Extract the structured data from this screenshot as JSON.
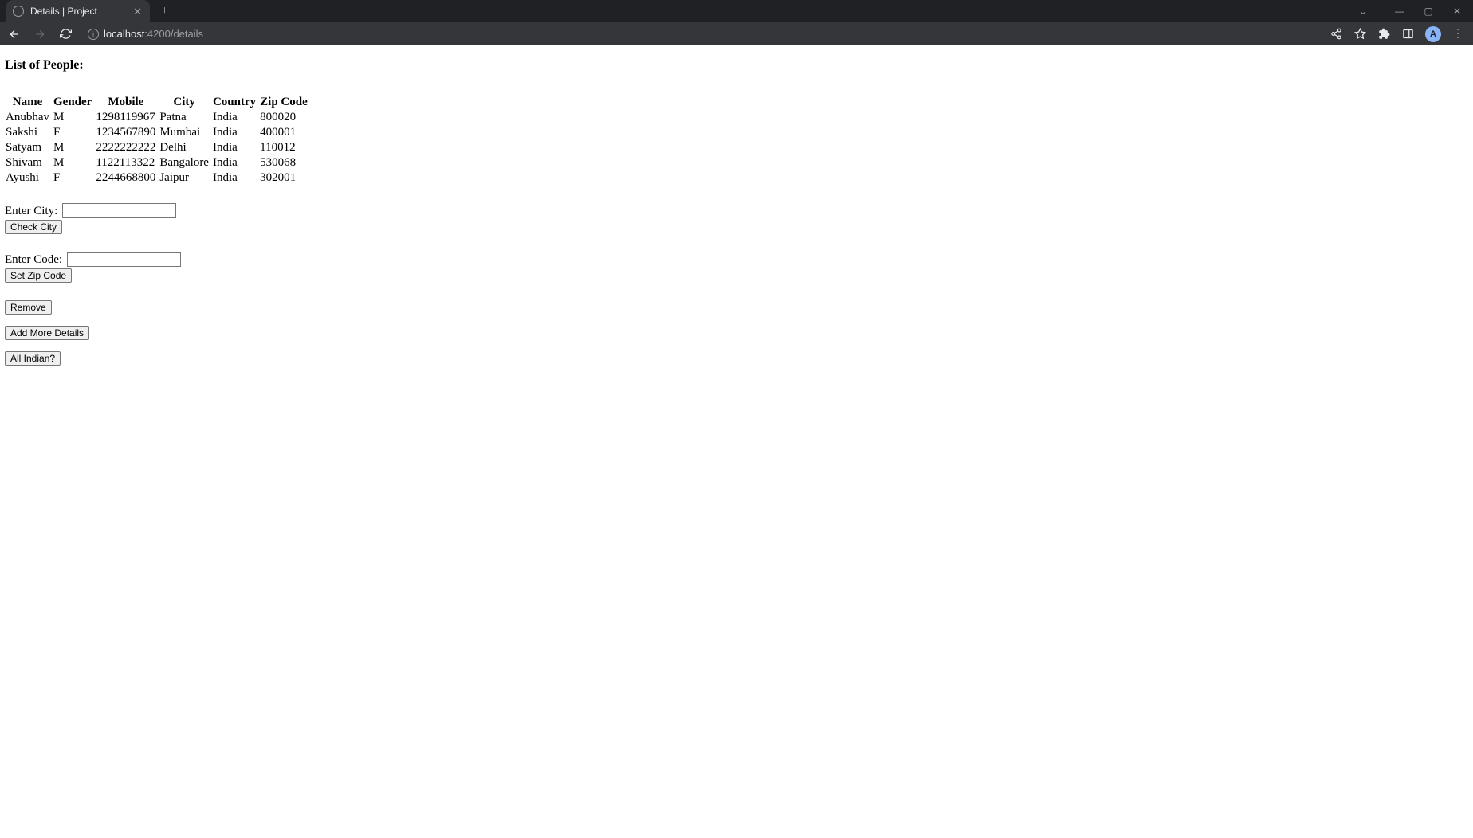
{
  "browser": {
    "tab_title": "Details | Project",
    "url_host": "localhost",
    "url_rest": ":4200/details",
    "avatar_letter": "A"
  },
  "page": {
    "heading": "List of People:",
    "table": {
      "headers": [
        "Name",
        "Gender",
        "Mobile",
        "City",
        "Country",
        "Zip Code"
      ],
      "rows": [
        {
          "name": "Anubhav",
          "gender": "M",
          "mobile": "1298119967",
          "city": "Patna",
          "country": "India",
          "zip": "800020"
        },
        {
          "name": "Sakshi",
          "gender": "F",
          "mobile": "1234567890",
          "city": "Mumbai",
          "country": "India",
          "zip": "400001"
        },
        {
          "name": "Satyam",
          "gender": "M",
          "mobile": "2222222222",
          "city": "Delhi",
          "country": "India",
          "zip": "110012"
        },
        {
          "name": "Shivam",
          "gender": "M",
          "mobile": "1122113322",
          "city": "Bangalore",
          "country": "India",
          "zip": "530068"
        },
        {
          "name": "Ayushi",
          "gender": "F",
          "mobile": "2244668800",
          "city": "Jaipur",
          "country": "India",
          "zip": "302001"
        }
      ]
    },
    "city_label": "Enter City: ",
    "city_value": "",
    "check_city_button": "Check City",
    "code_label": "Enter Code: ",
    "code_value": "",
    "set_zip_button": "Set Zip Code",
    "remove_button": "Remove",
    "add_more_button": "Add More Details",
    "all_indian_button": "All Indian?"
  }
}
